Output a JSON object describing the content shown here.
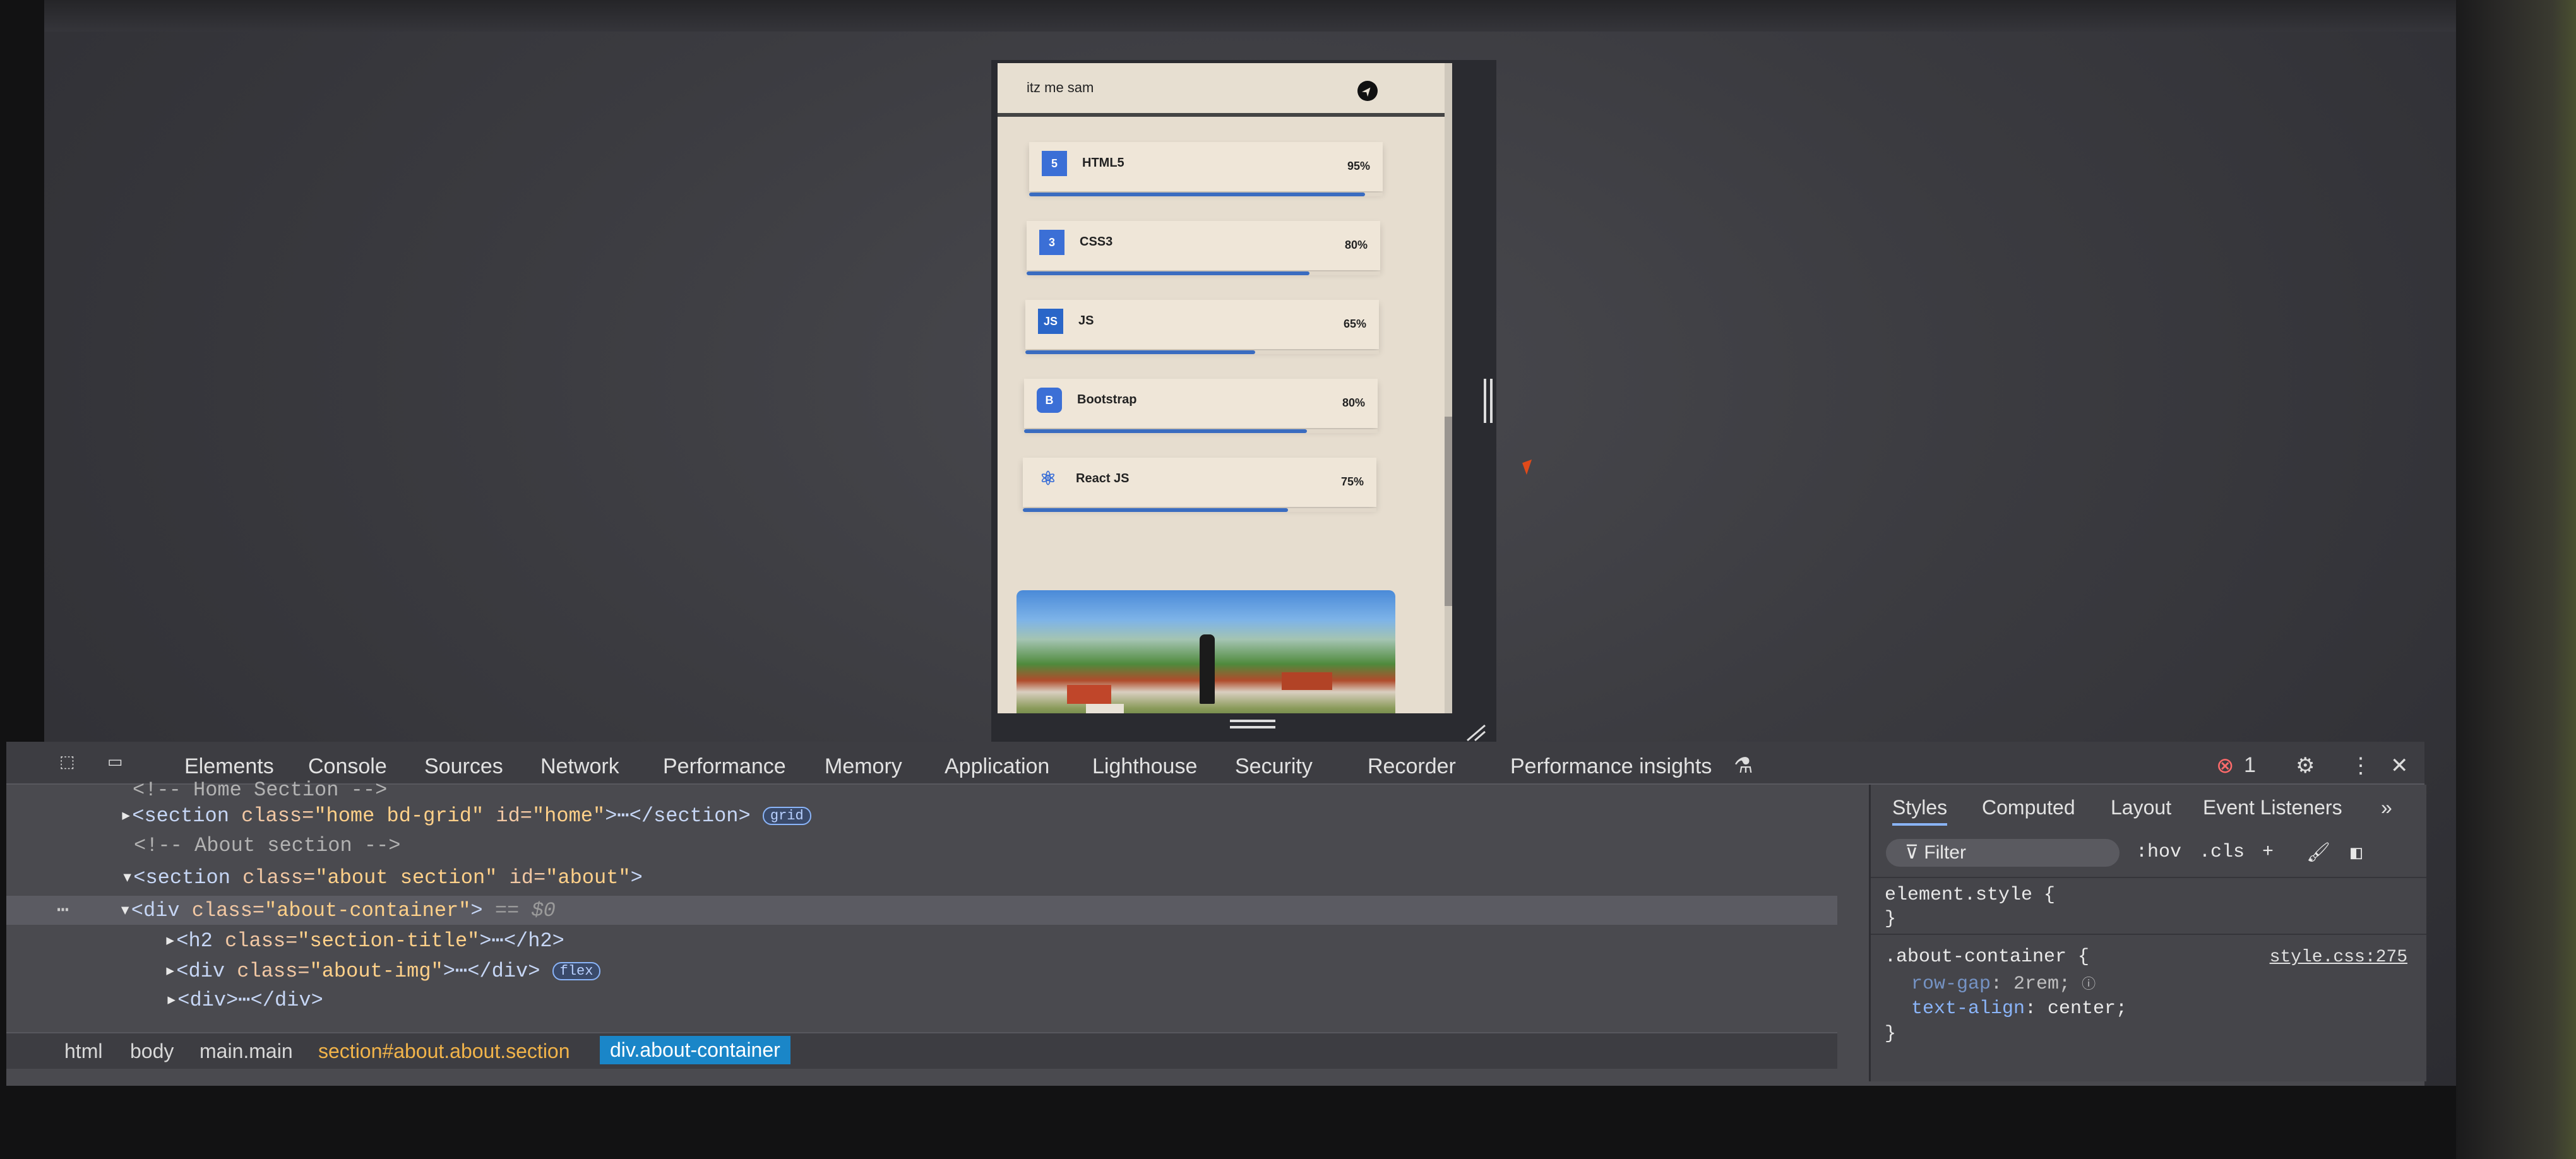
{
  "app": {
    "logo": "itz me sam",
    "skills": [
      {
        "name": "HTML5",
        "percent": "95%",
        "icon": "html5-icon",
        "level": 0.95
      },
      {
        "name": "CSS3",
        "percent": "80%",
        "icon": "css3-icon",
        "level": 0.8
      },
      {
        "name": "JS",
        "percent": "65%",
        "icon": "js-icon",
        "level": 0.65
      },
      {
        "name": "Bootstrap",
        "percent": "80%",
        "icon": "bootstrap-icon",
        "level": 0.8
      },
      {
        "name": "React JS",
        "percent": "75%",
        "icon": "react-icon",
        "level": 0.75
      }
    ],
    "icon_text": {
      "html": "5",
      "css": "3",
      "js": "JS",
      "bootstrap": "B",
      "react": "⚛"
    }
  },
  "devtools": {
    "tabs": [
      "Elements",
      "Console",
      "Sources",
      "Network",
      "Performance",
      "Memory",
      "Application",
      "Lighthouse",
      "Security",
      "Recorder",
      "Performance insights"
    ],
    "error_count": "1",
    "dom": {
      "line0": "<!-- Home Section -->",
      "line1_tag": "<section",
      "line1_class_attr": " class=",
      "line1_class_val": "\"home bd-grid\"",
      "line1_id_attr": " id=",
      "line1_id_val": "\"home\"",
      "line1_end": ">⋯</section>",
      "line1_badge": "grid",
      "line2": "<!-- About section -->",
      "line3_tag": "<section",
      "line3_class_attr": " class=",
      "line3_class_val": "\"about section\"",
      "line3_id_attr": " id=",
      "line3_id_val": "\"about\"",
      "line3_end": ">",
      "line4_tag": "<div",
      "line4_class_attr": " class=",
      "line4_class_val": "\"about-container\"",
      "line4_end": ">",
      "line4_eq": " == $0",
      "line5_tag": "<h2",
      "line5_class_attr": " class=",
      "line5_class_val": "\"section-title\"",
      "line5_end": ">⋯</h2>",
      "line6_tag": "<div",
      "line6_class_attr": " class=",
      "line6_class_val": "\"about-img\"",
      "line6_end": ">⋯</div>",
      "line6_badge": "flex",
      "line7": "<div>⋯</div>"
    },
    "breadcrumb": [
      "html",
      "body",
      "main.main",
      "section#about.about.section",
      "div.about-container"
    ],
    "styles": {
      "tabs": [
        "Styles",
        "Computed",
        "Layout",
        "Event Listeners"
      ],
      "filter_placeholder": "Filter",
      "hov": ":hov",
      "cls": ".cls",
      "element_style": "element.style {",
      "close_brace": "}",
      "rule_selector": ".about-container {",
      "rule_source": "style.css:275",
      "prop1_name": "row-gap",
      "prop1_value": ": 2rem;",
      "prop2_name": "text-align",
      "prop2_value": ": center;"
    }
  },
  "colors": {
    "accent": "#3a6cc0",
    "selected_crumb": "#1a86c8",
    "bg": "#e6ddcf"
  }
}
